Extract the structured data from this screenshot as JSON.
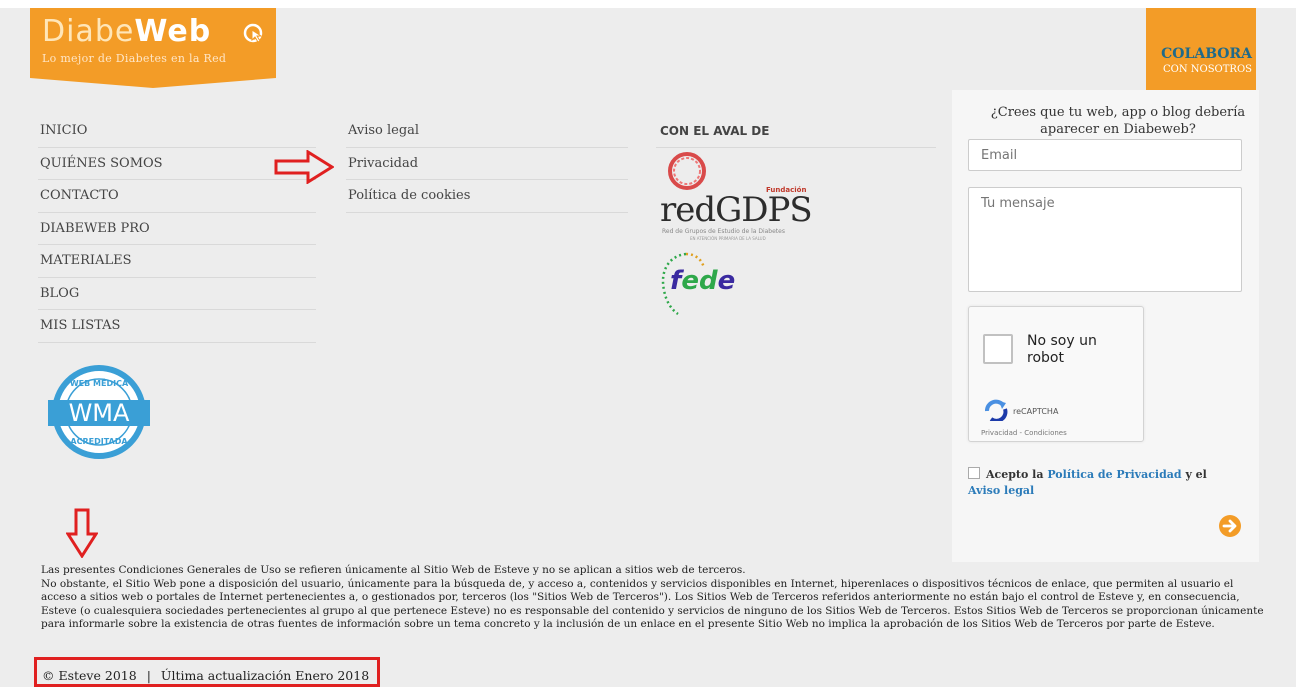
{
  "logo": {
    "title_part1": "Diabe",
    "title_part2": "Web",
    "subtitle": "Lo mejor de Diabetes en la Red"
  },
  "colabora": {
    "line1": "COLABORA",
    "line2": "CON NOSOTROS"
  },
  "nav_main": [
    "INICIO",
    "QUIÉNES SOMOS",
    "CONTACTO",
    "DIABEWEB PRO",
    "MATERIALES",
    "BLOG",
    "MIS LISTAS"
  ],
  "nav_legal": [
    "Aviso legal",
    "Privacidad",
    "Política de cookies"
  ],
  "aval": {
    "title": "CON EL AVAL DE",
    "redgdps_fundacion": "Fundación",
    "redgdps_name": "redGDPS",
    "redgdps_sub1": "Red de Grupos de Estudio de la Diabetes",
    "redgdps_sub2": "EN ATENCIÓN PRIMARIA DE LA SALUD",
    "fede_f": "f",
    "fede_ed": "ed",
    "fede_e": "e"
  },
  "wma": {
    "top": "WEB MÉDICA",
    "center": "WMA",
    "bottom": "ACREDITADA"
  },
  "form": {
    "question": "¿Crees que tu web, app o blog debería aparecer en Diabeweb?",
    "email_placeholder": "Email",
    "message_placeholder": "Tu mensaje",
    "captcha_label": "No soy un robot",
    "captcha_brand": "reCAPTCHA",
    "captcha_links": "Privacidad - Condiciones",
    "accept_prefix": "Acepto la",
    "accept_link1": "Política de Privacidad",
    "accept_mid": "y el",
    "accept_link2": "Aviso legal"
  },
  "legal": [
    "Las presentes Condiciones Generales de Uso se refieren únicamente al Sitio Web de Esteve y no se aplican a sitios web de terceros.",
    "No obstante, el Sitio Web pone a disposición del usuario, únicamente para la búsqueda de, y acceso a, contenidos y servicios disponibles en Internet, hiperenlaces o dispositivos técnicos de enlace, que permiten al usuario el acceso a sitios web o portales de Internet pertenecientes a, o gestionados por, terceros (los \"Sitios Web de Terceros\"). Los Sitios Web de Terceros referidos anteriormente no están bajo el control de Esteve y, en consecuencia, Esteve (o cualesquiera sociedades pertenecientes al grupo al que pertenece Esteve) no es responsable del contenido y servicios de ninguno de los Sitios Web de Terceros. Estos Sitios Web de Terceros se proporcionan únicamente para informarle sobre la existencia de otras fuentes de información sobre un tema concreto y la inclusión de un enlace en el presente Sitio Web no implica la aprobación de los Sitios Web de Terceros por parte de Esteve."
  ],
  "footer": {
    "copyright": "© Esteve 2018",
    "separator": "|",
    "updated": "Última actualización Enero 2018"
  },
  "colors": {
    "orange": "#f39c27",
    "annotation_red": "#e02020",
    "link_blue": "#2b7bb9"
  }
}
